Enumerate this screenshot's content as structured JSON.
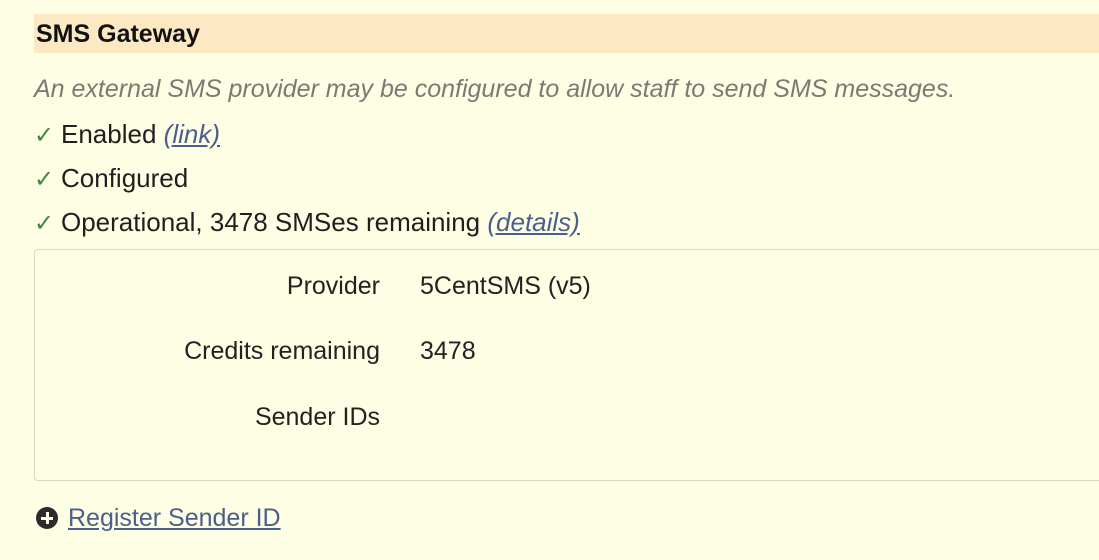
{
  "header": {
    "title": "SMS Gateway"
  },
  "description": "An external SMS provider may be configured to allow staff to send SMS messages.",
  "status": [
    {
      "check": "✓",
      "text": "Enabled",
      "link": "(link)"
    },
    {
      "check": "✓",
      "text": "Configured"
    },
    {
      "check": "✓",
      "text": "Operational, 3478 SMSes remaining",
      "link": "(details)"
    }
  ],
  "details": {
    "rows": [
      {
        "label": "Provider",
        "value": "5CentSMS (v5)"
      },
      {
        "label": "Credits remaining",
        "value": "3478"
      },
      {
        "label": "Sender IDs",
        "value": ""
      }
    ]
  },
  "actions": {
    "register_label": "Register Sender ID",
    "register_icon": "plus-circle-icon"
  },
  "colors": {
    "background": "#fefee4",
    "header": "#fce9c4",
    "check": "#3d8a3d",
    "link": "#4a5f8c"
  }
}
